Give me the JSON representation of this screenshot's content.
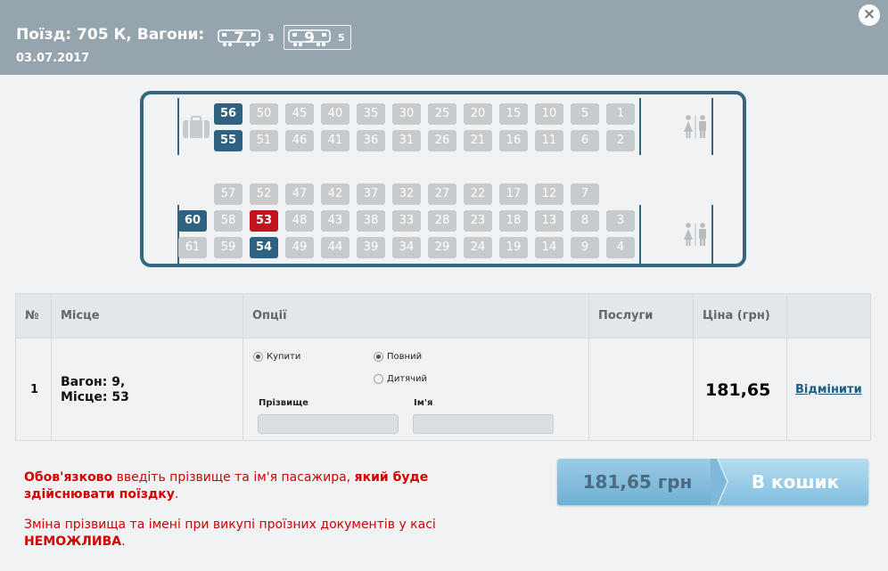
{
  "header": {
    "title": "Поїзд: 705 К, Вагони:",
    "date": "03.07.2017",
    "close_label": "×",
    "wagons": [
      {
        "number": "7",
        "free": "3",
        "selected": false
      },
      {
        "number": "9",
        "free": "5",
        "selected": true
      }
    ]
  },
  "car": {
    "top_row1": [
      "56",
      "50",
      "45",
      "40",
      "35",
      "30",
      "25",
      "20",
      "15",
      "10",
      "5",
      "1"
    ],
    "top_row2": [
      "55",
      "51",
      "46",
      "41",
      "36",
      "31",
      "26",
      "21",
      "16",
      "11",
      "6",
      "2"
    ],
    "bot_row1": [
      "57",
      "52",
      "47",
      "42",
      "37",
      "32",
      "27",
      "22",
      "17",
      "12",
      "7"
    ],
    "bot_row2": [
      "60",
      "58",
      "53",
      "48",
      "43",
      "38",
      "33",
      "28",
      "23",
      "18",
      "13",
      "8",
      "3"
    ],
    "bot_row3": [
      "61",
      "59",
      "54",
      "49",
      "44",
      "39",
      "34",
      "29",
      "24",
      "19",
      "14",
      "9",
      "4"
    ],
    "available": [
      "56",
      "55",
      "60",
      "54"
    ],
    "selected": [
      "53"
    ],
    "icons": {
      "luggage": "luggage-icon",
      "toilet": "toilet-icon"
    }
  },
  "table": {
    "headers": [
      "№",
      "Місце",
      "Опції",
      "Послуги",
      "Ціна (грн)",
      ""
    ],
    "row": {
      "num": "1",
      "place_line1": "Вагон: 9,",
      "place_line2": "Місце: 53",
      "opt_buy": "Купити",
      "opt_full": "Повний",
      "opt_child": "Дитячий",
      "surname_label": "Прізвище",
      "name_label": "Ім'я",
      "surname_value": "",
      "name_value": "",
      "price": "181,65",
      "cancel": "Відмінити"
    }
  },
  "notice": {
    "p1_a": "Обов'язково",
    "p1_b": " введіть прізвище та ім'я пасажира, ",
    "p1_c": "який буде здійснювати поїздку",
    "p1_d": ".",
    "p2_a": "Зміна прізвища та імені при викупі проїзних документів у касі ",
    "p2_b": "НЕМОЖЛИВА",
    "p2_c": "."
  },
  "cart": {
    "price": "181,65 грн",
    "label": "В кошик"
  },
  "colors": {
    "header_bg": "#95a4ad",
    "seat_free_other": "#c8cbcd",
    "seat_available": "#2f6180",
    "seat_selected": "#c0141f",
    "warning": "#d40000"
  }
}
